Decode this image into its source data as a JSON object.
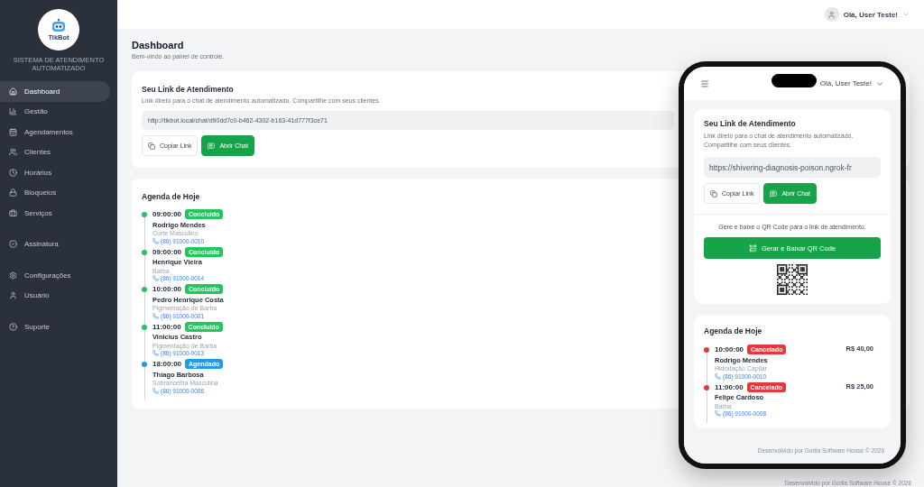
{
  "sidebar": {
    "logo_text": "TikBot",
    "tagline": "SISTEMA DE ATENDIMENTO AUTOMATIZADO",
    "groups": [
      {
        "items": [
          {
            "label": "Dashboard",
            "selected": true
          },
          {
            "label": "Gestão",
            "selected": false
          },
          {
            "label": "Agendamentos",
            "selected": false
          },
          {
            "label": "Clientes",
            "selected": false
          },
          {
            "label": "Horários",
            "selected": false
          },
          {
            "label": "Bloqueios",
            "selected": false
          },
          {
            "label": "Serviços",
            "selected": false
          }
        ]
      },
      {
        "items": [
          {
            "label": "Assinatura",
            "selected": false
          }
        ]
      },
      {
        "items": [
          {
            "label": "Configurações",
            "selected": false
          },
          {
            "label": "Usuário",
            "selected": false
          }
        ]
      },
      {
        "items": [
          {
            "label": "Suporte",
            "selected": false
          }
        ]
      }
    ]
  },
  "topbar": {
    "greeting": "Olá, User Teste!"
  },
  "page": {
    "title": "Dashboard",
    "subtitle": "Bem-vindo ao painel de controle."
  },
  "link_card": {
    "title": "Seu Link de Atendimento",
    "description": "Link direto para o chat de atendimento automatizado. Compartilhe com seus clientes.",
    "url": "http://tikbot.local/chat/d90dd7c0-b462-4302-b163-41d777f3ce71",
    "buttons": [
      {
        "kind": "copy",
        "label": "Copiar Link"
      },
      {
        "kind": "chat",
        "label": "Abrir Chat"
      }
    ]
  },
  "agenda": {
    "title": "Agenda de Hoje",
    "appointments": [
      {
        "time": "09:00:00",
        "status": "Concluído",
        "color": "#22c55e",
        "name": "Rodrigo Mendes",
        "service": "Corte Masculino",
        "phone": "(86) 91000-0010"
      },
      {
        "time": "09:00:00",
        "status": "Concluído",
        "color": "#22c55e",
        "name": "Henrique Vieira",
        "service": "Barba",
        "phone": "(86) 91000-0014"
      },
      {
        "time": "10:00:00",
        "status": "Concluído",
        "color": "#22c55e",
        "name": "Pedro Henrique Costa",
        "service": "Pigmentação de Barba",
        "phone": "(86) 91000-0001"
      },
      {
        "time": "11:00:00",
        "status": "Concluído",
        "color": "#22c55e",
        "name": "Vinicius Castro",
        "service": "Pigmentação de Barba",
        "phone": "(86) 91000-0013"
      },
      {
        "time": "18:00:00",
        "status": "Agendado",
        "color": "#1d9bf0",
        "name": "Thiago Barbosa",
        "service": "Sobrancelha Masculina",
        "phone": "(86) 91000-0006"
      }
    ]
  },
  "phone": {
    "greeting": "Olá, User Teste!",
    "link_card": {
      "title": "Seu Link de Atendimento",
      "description": "Link direto para o chat de atendimento automatizado. Compartilhe com seus clientes.",
      "url": "https://shivering-diagnosis-poison.ngrok-fr",
      "buttons": [
        {
          "kind": "copy",
          "label": "Copiar Link"
        },
        {
          "kind": "chat",
          "label": "Abrir Chat"
        }
      ]
    },
    "qr": {
      "hint": "Gere e baixe o QR Code para o link de atendimento.",
      "button": "Gerar e Baixar QR Code"
    },
    "agenda": {
      "title": "Agenda de Hoje",
      "appointments": [
        {
          "time": "10:00:00",
          "status": "Cancelado",
          "color": "#e5383b",
          "price": "R$ 40,00",
          "name": "Rodrigo Mendes",
          "service": "Hidratação Capilar",
          "phone": "(86) 91000-0010"
        },
        {
          "time": "11:00:00",
          "status": "Cancelado",
          "color": "#e5383b",
          "price": "R$ 25,00",
          "name": "Felipe Cardoso",
          "service": "Barba",
          "phone": "(86) 91000-0008"
        }
      ]
    },
    "footer": "Desenvolvido por Gorila Software House © 2026"
  },
  "footer": "Desenvolvido por Gorila Software House © 2026"
}
